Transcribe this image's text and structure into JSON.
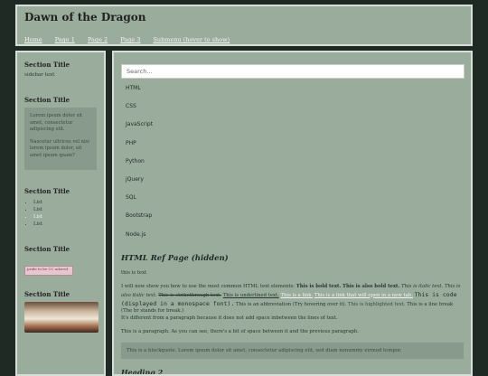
{
  "header": {
    "title": "Dawn of the Dragon",
    "nav": [
      "Home",
      "Page 1",
      "Page 2",
      "Page 3",
      "Submenu (hover to show)"
    ]
  },
  "sidebar": {
    "sections": [
      {
        "title": "Section Title",
        "text": "sidebar text"
      },
      {
        "title": "Section Title",
        "paragraphs": [
          "Lorem ipsum dolor sit amet, consectetur adipiscing elit.",
          "Nascetur ultrices vel nisi lorem ipsum dolor, sit amet ipsum quam?"
        ]
      },
      {
        "title": "Section Title",
        "list": [
          "List",
          "List",
          "List",
          "List"
        ],
        "active_index": 2
      },
      {
        "title": "Section Title",
        "badge_text": "pride to be CC adored"
      },
      {
        "title": "Section Title"
      }
    ]
  },
  "main": {
    "search_placeholder": "Search...",
    "languages": [
      "HTML",
      "CSS",
      "JavaScript",
      "PHP",
      "Python",
      "jQuery",
      "SQL",
      "Bootstrap",
      "Node.js"
    ],
    "ref_title": "HTML Ref Page (hidden)",
    "intro": "this is text",
    "p1a": "I will now show you how to use the most common HTML text elements:",
    "p1b": "This is bold text.",
    "p1c": "This is also bold text.",
    "p1d": "This is italic text.",
    "p1e": "This is also italic text.",
    "p2a": "This is strikethrough text.",
    "p2b": "This is underlined text.",
    "p2c": "This is a link.",
    "p2d": "This is a link that will open in a new tab.",
    "p2e": "This is code (displayed in a monospace font).",
    "p2f": "This is an abbreviation (Try hovering over it).",
    "p2g": "This is highlighted text.",
    "p2h": "This is a line break (The br stands for break.)",
    "p2i": "It's different from a paragraph because it does not add space inbetween the lines of text.",
    "p3": "This is a paragraph. As you can see, there's a bit of space between it and the previous paragraph.",
    "blockquote": "This is a blockquote. Lorem ipsum dolor sit amet, consectetur adipiscing elit, sed diam nonummy eirmod tempor.",
    "subheading": "Heading 2"
  }
}
